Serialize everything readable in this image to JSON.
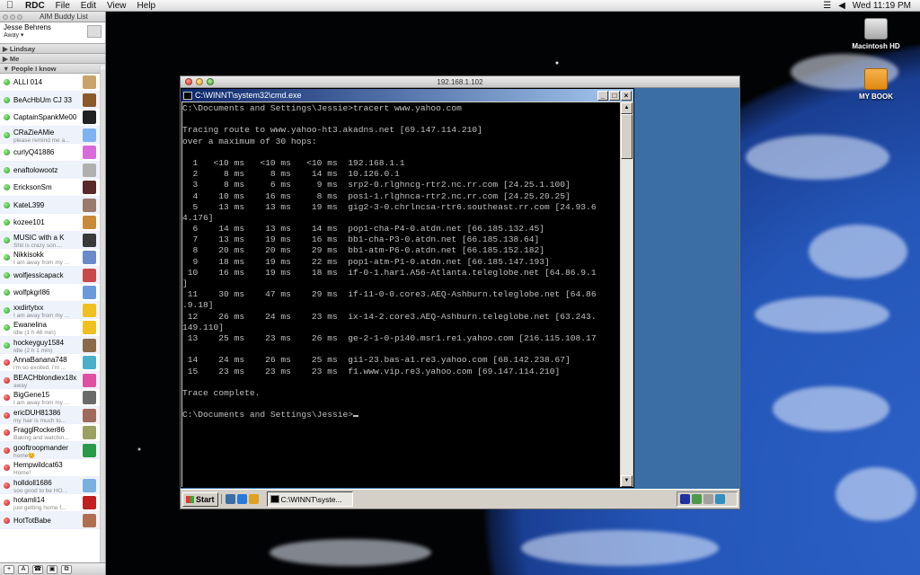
{
  "menubar": {
    "apple_icon": "apple-icon",
    "items": [
      "RDC",
      "File",
      "Edit",
      "View",
      "Help"
    ],
    "clock": "Wed 11:19 PM",
    "status_icons": [
      "wifi-icon",
      "volume-icon"
    ]
  },
  "desktop": {
    "icons": [
      {
        "label": "Macintosh HD",
        "icon": "hard-drive-icon"
      },
      {
        "label": "MY BOOK",
        "icon": "external-drive-icon"
      }
    ]
  },
  "buddylist": {
    "window_title": "AIM Buddy List",
    "me": {
      "name": "Jesse Behrens",
      "status": "Away ▾"
    },
    "groups": [
      {
        "name": "▶ Lindsay"
      },
      {
        "name": "▶ Me"
      },
      {
        "name": "▼ People I know"
      }
    ],
    "buddies": [
      {
        "name": "ALLI 014",
        "status": "",
        "state": "green",
        "avatar": "#c8a36a"
      },
      {
        "name": "BeAcHbUm CJ 33",
        "status": "",
        "state": "green",
        "avatar": "#8a5a2a"
      },
      {
        "name": "CaptainSpankMe00",
        "status": "",
        "state": "green",
        "avatar": "#222222"
      },
      {
        "name": "CRaZieAMie",
        "status": "please remind me a...",
        "state": "green",
        "avatar": "#7fb2f0"
      },
      {
        "name": "curlyQ41886",
        "status": "",
        "state": "green",
        "avatar": "#d96bd9"
      },
      {
        "name": "enaftolowootz",
        "status": "",
        "state": "green",
        "avatar": "#b0b0b0"
      },
      {
        "name": "EricksonSm",
        "status": "",
        "state": "green",
        "avatar": "#5a2a2a"
      },
      {
        "name": "KateL399",
        "status": "",
        "state": "green",
        "avatar": "#9a7a6a"
      },
      {
        "name": "kozee101",
        "status": "",
        "state": "green",
        "avatar": "#c98a3a"
      },
      {
        "name": "MUSIC with a K",
        "status": "Shit is crazy son....",
        "state": "green",
        "avatar": "#3a3a3a"
      },
      {
        "name": "Nikkisokk",
        "status": "I am away from my ...",
        "state": "green",
        "avatar": "#6a8ac9"
      },
      {
        "name": "wolfjessicapack",
        "status": "",
        "state": "green",
        "avatar": "#c94a4a"
      },
      {
        "name": "wolfpkgrl86",
        "status": "",
        "state": "green",
        "avatar": "#6a9ad9"
      },
      {
        "name": "xxdirtytxx",
        "status": "I am away from my ...",
        "state": "green",
        "avatar": "#f0c020"
      },
      {
        "name": "Ewanelina",
        "status": "Idle (1 h 46 min)",
        "state": "green",
        "avatar": "#f0c020"
      },
      {
        "name": "hockeyguy1584",
        "status": "Idle (2 h 1 min)",
        "state": "green",
        "avatar": "#8a6a4a"
      },
      {
        "name": "AnnaBanana748",
        "status": "i'm so excited.  i'm ...",
        "state": "red",
        "avatar": "#4ab0c9"
      },
      {
        "name": "BEACHblondiex18x",
        "status": "away",
        "state": "red",
        "avatar": "#e050a0"
      },
      {
        "name": "BigGene15",
        "status": "I am away from my ...",
        "state": "red",
        "avatar": "#6a6a6a"
      },
      {
        "name": "ericDUH81386",
        "status": "my hair is much to...",
        "state": "red",
        "avatar": "#a06a5a"
      },
      {
        "name": "FragglRocker86",
        "status": "Baking and watchin...",
        "state": "red",
        "avatar": "#9aa060"
      },
      {
        "name": "gooftroopmander",
        "status": "home😊",
        "state": "red",
        "avatar": "#2a9a4a"
      },
      {
        "name": "Hempwildcat63",
        "status": "Home!",
        "state": "red",
        "avatar": "#ffffff"
      },
      {
        "name": "holldoll1686",
        "status": "soo good to be HO...",
        "state": "red",
        "avatar": "#7ab0e0"
      },
      {
        "name": "hotamli14",
        "status": "just getting home f...",
        "state": "red",
        "avatar": "#c02020"
      },
      {
        "name": "HotTotBabe",
        "status": "",
        "state": "red",
        "avatar": "#b07050"
      }
    ],
    "toolbar": [
      "+",
      "A",
      "☎",
      "▣",
      "⧉"
    ]
  },
  "rdc_window": {
    "title": "192.168.1.102",
    "cmd": {
      "title": "C:\\WINNT\\system32\\cmd.exe",
      "buttons": [
        "_",
        "□",
        "×"
      ],
      "lines": [
        "C:\\Documents and Settings\\Jessie>tracert www.yahoo.com",
        "",
        "Tracing route to www.yahoo-ht3.akadns.net [69.147.114.210]",
        "over a maximum of 30 hops:",
        "",
        "  1   <10 ms   <10 ms   <10 ms  192.168.1.1",
        "  2     8 ms     8 ms    14 ms  10.126.0.1",
        "  3     8 ms     6 ms     9 ms  srp2-0.rlghncg-rtr2.nc.rr.com [24.25.1.100]",
        "  4    10 ms    16 ms     8 ms  pos1-1.rlghnca-rtr2.nc.rr.com [24.25.20.25]",
        "  5    13 ms    13 ms    19 ms  gig2-3-0.chrlncsa-rtr6.southeast.rr.com [24.93.6",
        "4.176]",
        "  6    14 ms    13 ms    14 ms  pop1-cha-P4-0.atdn.net [66.185.132.45]",
        "  7    13 ms    19 ms    16 ms  bb1-cha-P3-0.atdn.net [66.185.138.64]",
        "  8    20 ms    20 ms    29 ms  bb1-atm-P6-0.atdn.net [66.185.152.182]",
        "  9    18 ms    19 ms    22 ms  pop1-atm-P1-0.atdn.net [66.185.147.193]",
        " 10    16 ms    19 ms    18 ms  if-0-1.har1.A56-Atlanta.teleglobe.net [64.86.9.1",
        "]",
        " 11    30 ms    47 ms    29 ms  if-11-0-0.core3.AEQ-Ashburn.teleglobe.net [64.86",
        ".9.18]",
        " 12    26 ms    24 ms    23 ms  ix-14-2.core3.AEQ-Ashburn.teleglobe.net [63.243.",
        "149.110]",
        " 13    25 ms    23 ms    26 ms  ge-2-1-0-p140.msr1.re1.yahoo.com [216.115.108.17",
        "",
        " 14    24 ms    26 ms    25 ms  gi1-23.bas-a1.re3.yahoo.com [68.142.238.67]",
        " 15    23 ms    23 ms    23 ms  f1.www.vip.re3.yahoo.com [69.147.114.210]",
        "",
        "Trace complete.",
        "",
        "C:\\Documents and Settings\\Jessie>"
      ]
    },
    "taskbar": {
      "start_label": "Start",
      "task_label": "C:\\WINNT\\syste..."
    }
  }
}
